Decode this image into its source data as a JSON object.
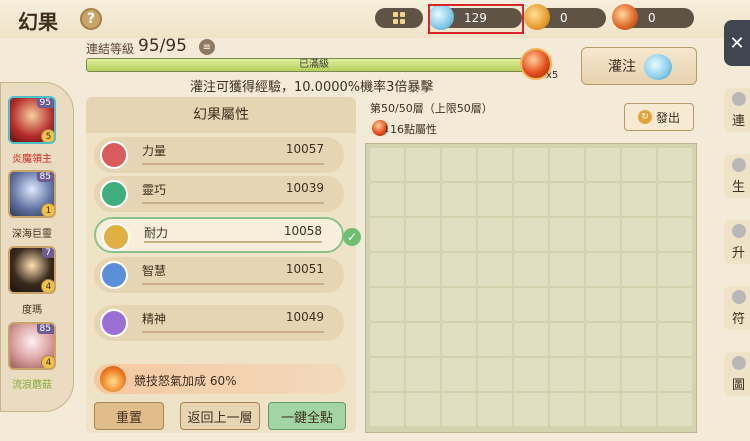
{
  "header": {
    "title": "幻果",
    "help_icon": "?"
  },
  "resources": [
    {
      "icon": "crystal-icon",
      "value": "129"
    },
    {
      "icon": "swirl-coin-icon",
      "value": "0"
    },
    {
      "icon": "feather-token-icon",
      "value": "0"
    }
  ],
  "level": {
    "label": "連結等級",
    "value": "95/95"
  },
  "exp_bar": {
    "text": "已滿級",
    "progress": 1.0
  },
  "exp_orb": {
    "count": "x5"
  },
  "hint": "灌注可獲得經驗，10.0000%機率3倍暴擊",
  "inject_button": {
    "label": "灌注"
  },
  "characters": [
    {
      "name": "炎魔領主",
      "level": "95",
      "stars": "5"
    },
    {
      "name": "深海巨靈",
      "level": "85",
      "stars": "1"
    },
    {
      "name": "度瑪",
      "level": "7",
      "stars": "4"
    },
    {
      "name": "流浪蘑菇",
      "level": "85",
      "stars": "4"
    }
  ],
  "attributes": {
    "title": "幻果屬性",
    "items": [
      {
        "name": "力量",
        "value": "10057"
      },
      {
        "name": "靈巧",
        "value": "10039"
      },
      {
        "name": "耐力",
        "value": "10058"
      },
      {
        "name": "智慧",
        "value": "10051"
      },
      {
        "name": "精神",
        "value": "10049"
      }
    ]
  },
  "bonus": "競技怒氣加成 60%",
  "buttons": {
    "reset": "重置",
    "back": "返回上一層",
    "auto": "一鍵全點"
  },
  "layer": {
    "info": "第50/50層（上限50層）",
    "sub_count": "1",
    "sub_text": "16點屬性",
    "leave": "發出"
  },
  "right_strip": [
    "連",
    "生",
    "升",
    "符",
    "圖"
  ]
}
